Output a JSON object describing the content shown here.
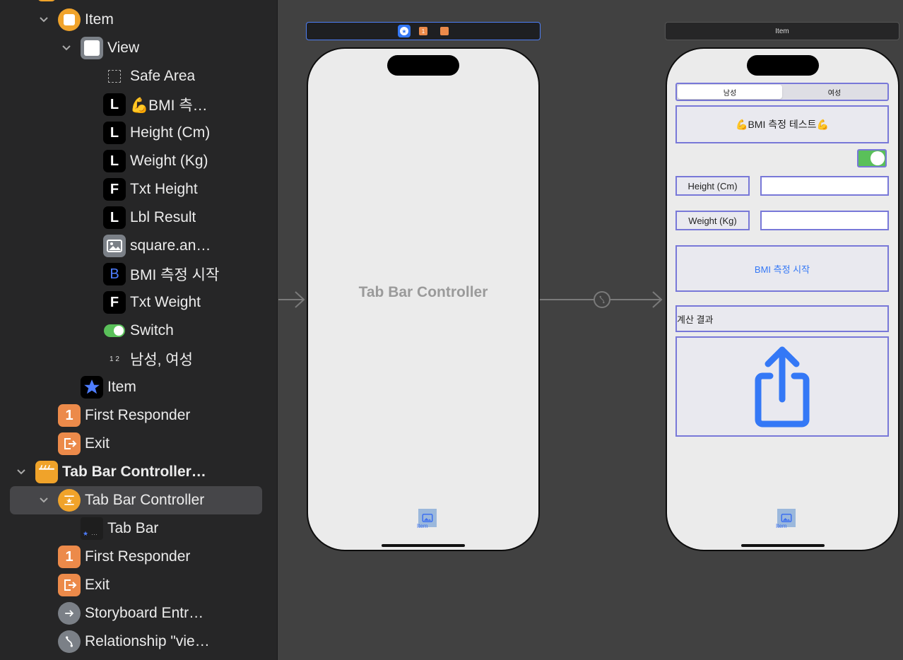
{
  "outline": {
    "items": [
      {
        "label": "Item",
        "bold": false
      },
      {
        "label": "View",
        "bold": false
      },
      {
        "label": "Safe Area",
        "bold": false
      },
      {
        "label": "💪BMI 측…",
        "badge": "L",
        "bold": false
      },
      {
        "label": "Height (Cm)",
        "badge": "L",
        "bold": false
      },
      {
        "label": "Weight (Kg)",
        "badge": "L",
        "bold": false
      },
      {
        "label": "Txt Height",
        "badge": "F",
        "bold": false
      },
      {
        "label": "Lbl Result",
        "badge": "L",
        "bold": false
      },
      {
        "label": "square.an…",
        "bold": false
      },
      {
        "label": "BMI 측정 시작",
        "badge": "B",
        "bold": false
      },
      {
        "label": "Txt Weight",
        "badge": "F",
        "bold": false
      },
      {
        "label": "Switch",
        "bold": false
      },
      {
        "label": "남성, 여성",
        "badge": "1 2",
        "bold": false
      },
      {
        "label": "Item",
        "bold": false
      },
      {
        "label": "First Responder",
        "badge": "1",
        "bold": false
      },
      {
        "label": "Exit",
        "bold": false
      },
      {
        "label": "Tab Bar Controller…",
        "bold": true
      },
      {
        "label": "Tab Bar Controller",
        "bold": false,
        "selected": true
      },
      {
        "label": "Tab Bar",
        "bold": false
      },
      {
        "label": "First Responder",
        "badge": "1",
        "bold": false
      },
      {
        "label": "Exit",
        "bold": false
      },
      {
        "label": "Storyboard Entr…",
        "bold": false
      },
      {
        "label": "Relationship \"vie…",
        "bold": false
      }
    ]
  },
  "tab_bar_scene": {
    "title": "Tab Bar Controller",
    "tab_label": "Item",
    "badge_first_responder": "1"
  },
  "item_scene": {
    "bar_title": "Item",
    "segment": {
      "options": [
        "남성",
        "여성"
      ],
      "selected": 0
    },
    "title_label": "💪BMI 측정 테스트💪",
    "switch_on": true,
    "height_label": "Height (Cm)",
    "height_value": "",
    "weight_label": "Weight (Kg)",
    "weight_value": "",
    "button_label": "BMI 측정 시작",
    "result_label": "계산 결과",
    "image_icon": "square-and-arrow-up-icon",
    "tab_label": "Item"
  },
  "colors": {
    "accent": "#3478f6",
    "outline_box": "#7878d8",
    "switch_on": "#5ac05a",
    "orange": "#f0a32a"
  }
}
